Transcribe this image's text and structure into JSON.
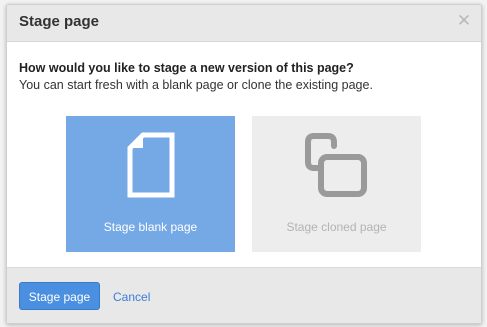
{
  "dialog": {
    "title": "Stage page",
    "close_icon": "close-icon",
    "question": "How would you like to stage a new version of this page?",
    "description": "You can start fresh with a blank page or clone the existing page.",
    "options": [
      {
        "label": "Stage blank page",
        "icon": "blank-page-icon",
        "selected": true
      },
      {
        "label": "Stage cloned page",
        "icon": "clone-page-icon",
        "selected": false
      }
    ],
    "primary_button": "Stage page",
    "cancel_label": "Cancel"
  },
  "colors": {
    "primary": "#4a8fe0",
    "selected_option": "#75a9e6",
    "unselected_option": "#ededed",
    "link": "#3b7dd8"
  }
}
